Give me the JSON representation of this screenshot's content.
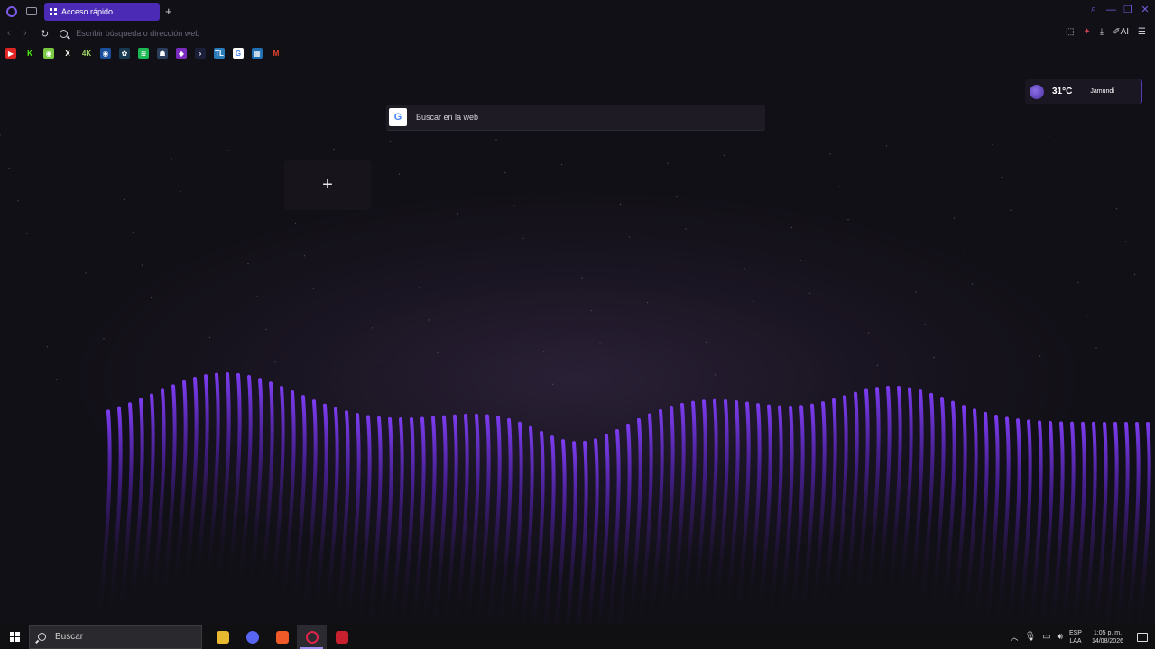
{
  "browser": {
    "tab_label": "Acceso rápido",
    "new_tab_symbol": "+",
    "address_placeholder": "Escribir búsqueda o dirección web",
    "bookmarks": [
      {
        "icon": "youtube-icon",
        "color": "#e02424",
        "glyph": "▶"
      },
      {
        "icon": "kick-icon",
        "color": "#111",
        "glyph": "K",
        "text_color": "#53fc18"
      },
      {
        "icon": "twitch-alt-icon",
        "color": "#7ac943",
        "glyph": "◉"
      },
      {
        "icon": "x-icon",
        "color": "#111",
        "glyph": "X"
      },
      {
        "icon": "4k-icon",
        "color": "#111",
        "glyph": "4K",
        "text_color": "#9fd36a"
      },
      {
        "icon": "eye-icon",
        "color": "#1a4f9c",
        "glyph": "◉"
      },
      {
        "icon": "chatgpt-icon",
        "color": "#1a3a52",
        "glyph": "✿"
      },
      {
        "icon": "spotify-icon",
        "color": "#1db954",
        "glyph": "≋"
      },
      {
        "icon": "robot-icon",
        "color": "#2b3f5c",
        "glyph": "☗"
      },
      {
        "icon": "pomelo-icon",
        "color": "#7b2cbf",
        "glyph": "◆"
      },
      {
        "icon": "terminal-icon",
        "color": "#1b1f3a",
        "glyph": "›"
      },
      {
        "icon": "trello-icon",
        "color": "#2b7bb9",
        "glyph": "TL"
      },
      {
        "icon": "google-icon",
        "color": "#ffffff",
        "glyph": "G",
        "text_color": "#4285f4"
      },
      {
        "icon": "grid-app-icon",
        "color": "#1f6fb2",
        "glyph": "▦"
      },
      {
        "icon": "gmail-icon",
        "color": "#111",
        "glyph": "M",
        "text_color": "#ea4335"
      }
    ]
  },
  "speed_dial": {
    "search_label": "Buscar en la web",
    "search_engine_icon": "google-icon",
    "add_symbol": "+"
  },
  "weather": {
    "temperature": "31°C",
    "city": "Jamundí"
  },
  "taskbar": {
    "search_label": "Buscar",
    "language_line1": "ESP",
    "language_line2": "LAA",
    "time": "1:05 p. m.",
    "date": "14/08/2026",
    "apps": [
      {
        "name": "file-explorer-icon",
        "color": "#e8b830",
        "active": false
      },
      {
        "name": "discord-icon",
        "color": "#5865f2",
        "active": false
      },
      {
        "name": "brave-icon",
        "color": "#f05a28",
        "active": false
      },
      {
        "name": "opera-gx-icon",
        "color": "#e0244a",
        "active": true
      },
      {
        "name": "app-red-icon",
        "color": "#c8202e",
        "active": false
      }
    ]
  },
  "colors": {
    "accent": "#4b2bb5",
    "wave": "#7c3cf0"
  }
}
